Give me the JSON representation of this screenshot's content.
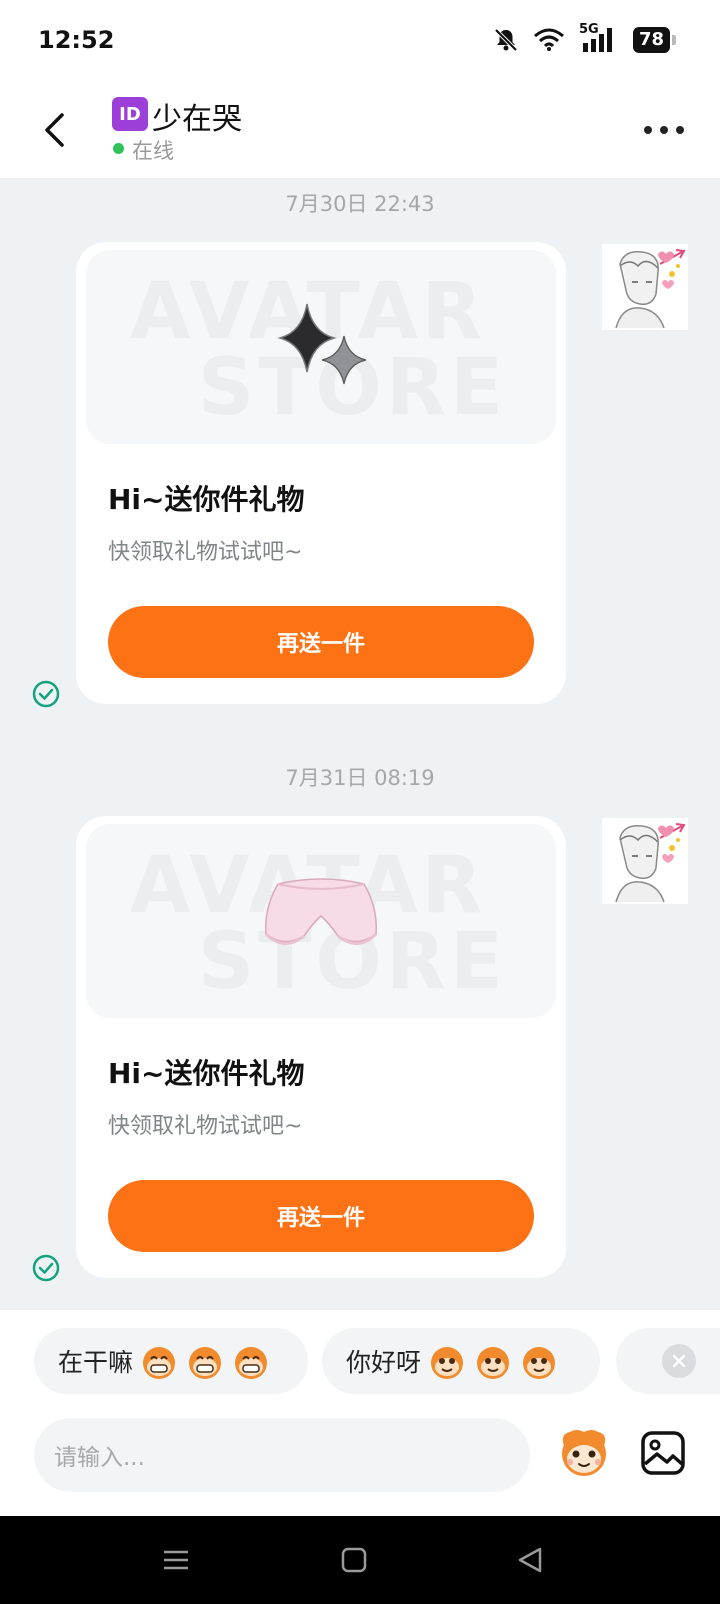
{
  "status_bar": {
    "time": "12:52",
    "network": "5G",
    "battery": "78"
  },
  "header": {
    "id_badge": "ID",
    "contact_name": "少在哭",
    "presence": "在线"
  },
  "messages": [
    {
      "timestamp": "7月30日 22:43",
      "card": {
        "watermark_top": "AVATAR",
        "watermark_bottom": "STORE",
        "title": "Hi~送你件礼物",
        "subtitle": "快领取礼物试试吧~",
        "button_label": "再送一件",
        "item": "sparkle"
      }
    },
    {
      "timestamp": "7月31日 08:19",
      "card": {
        "watermark_top": "AVATAR",
        "watermark_bottom": "STORE",
        "title": "Hi~送你件礼物",
        "subtitle": "快领取礼物试试吧~",
        "button_label": "再送一件",
        "item": "shorts"
      }
    }
  ],
  "quick_replies": [
    {
      "text": "在干嘛"
    },
    {
      "text": "你好呀"
    }
  ],
  "input": {
    "placeholder": "请输入..."
  },
  "colors": {
    "accent": "#fc7214",
    "online": "#2fc25b",
    "check": "#14a37f",
    "id_badge": "#9b3fd8"
  }
}
